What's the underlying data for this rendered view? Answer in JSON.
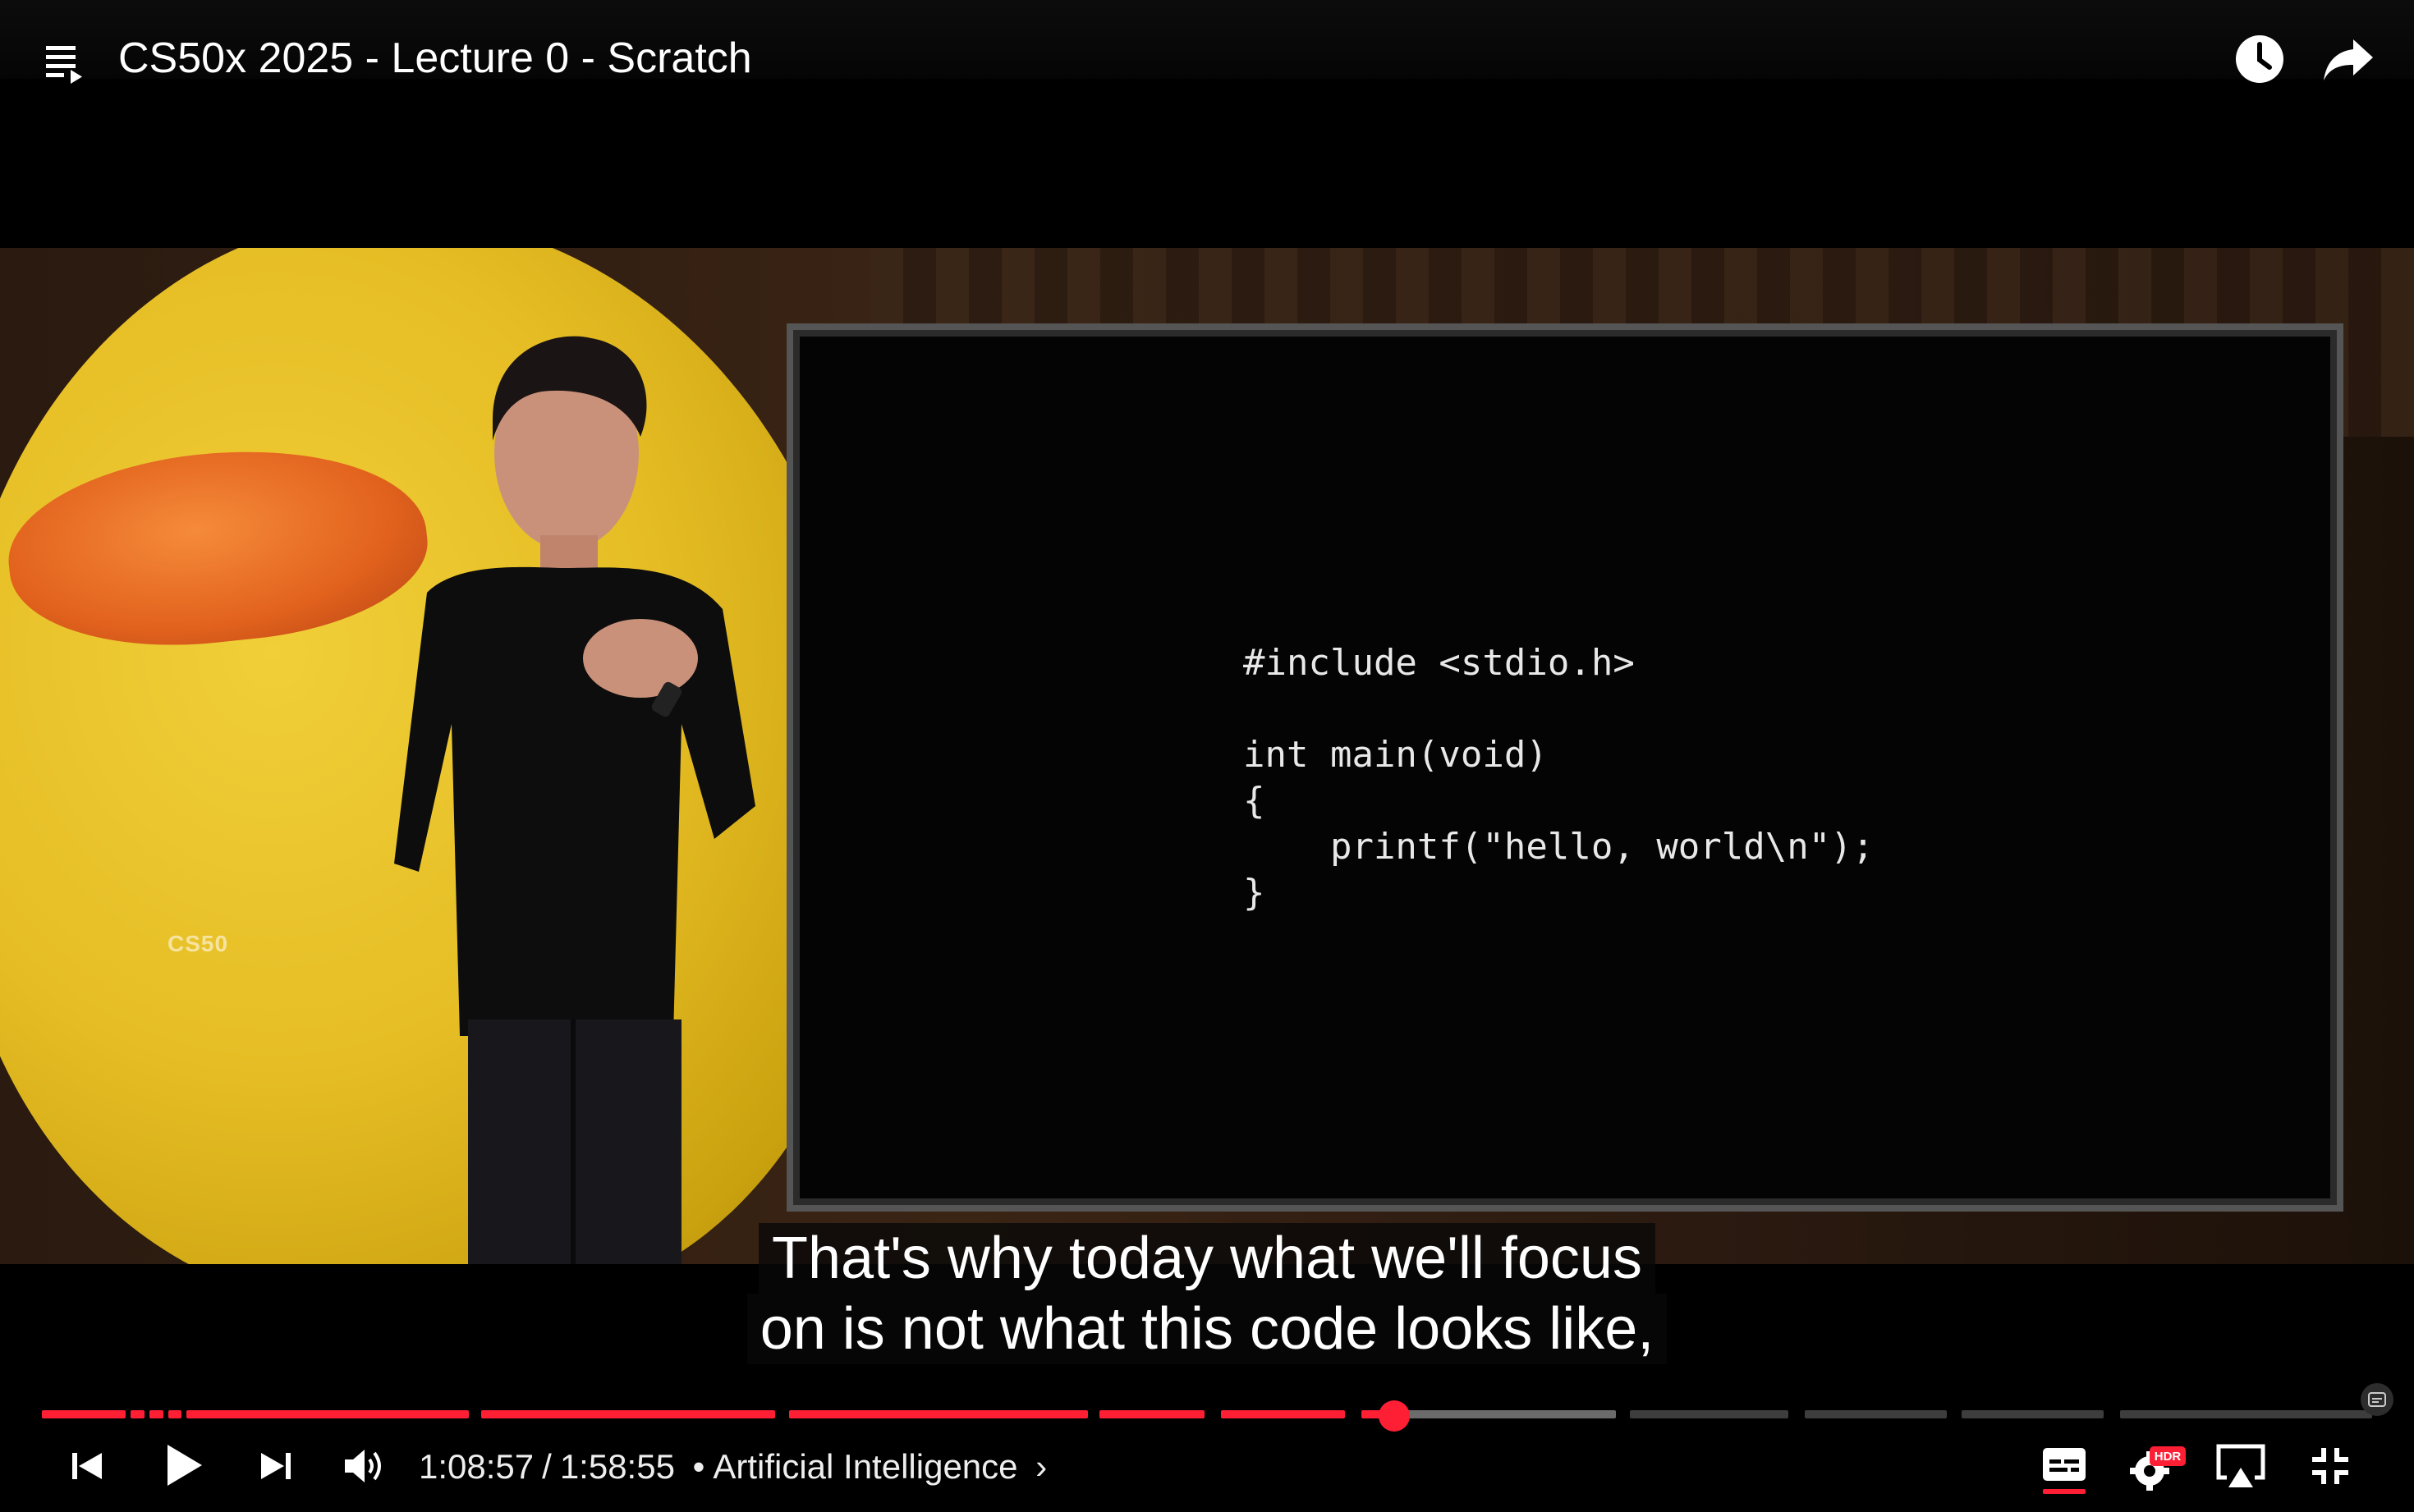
{
  "header": {
    "title": "CS50x 2025 - Lecture 0 - Scratch",
    "icons": [
      "playlist-icon",
      "clock-icon",
      "share-icon"
    ]
  },
  "video": {
    "backdrop_logo": "CS50",
    "slide_code": "#include <stdio.h>\n\nint main(void)\n{\n    printf(\"hello, world\\n\");\n}"
  },
  "captions": {
    "line1": "That's why today what we'll focus",
    "line2": "on is not what this code looks like,"
  },
  "player": {
    "current_time": "1:08:57",
    "duration": "1:58:55",
    "separator": "/",
    "chapter": "Artificial Intelligence",
    "chapter_arrow": "›",
    "progress_fraction": 0.58,
    "hdr_badge": "HDR",
    "colors": {
      "played": "#ff1f35",
      "buffered": "#6b6b6b",
      "unplayed": "#3d3d3d",
      "accent": "#ff1f35"
    },
    "icons": [
      "previous-icon",
      "play-icon",
      "next-icon",
      "volume-icon",
      "subtitles-icon",
      "settings-icon",
      "airplay-icon",
      "exit-fullscreen-icon"
    ]
  }
}
